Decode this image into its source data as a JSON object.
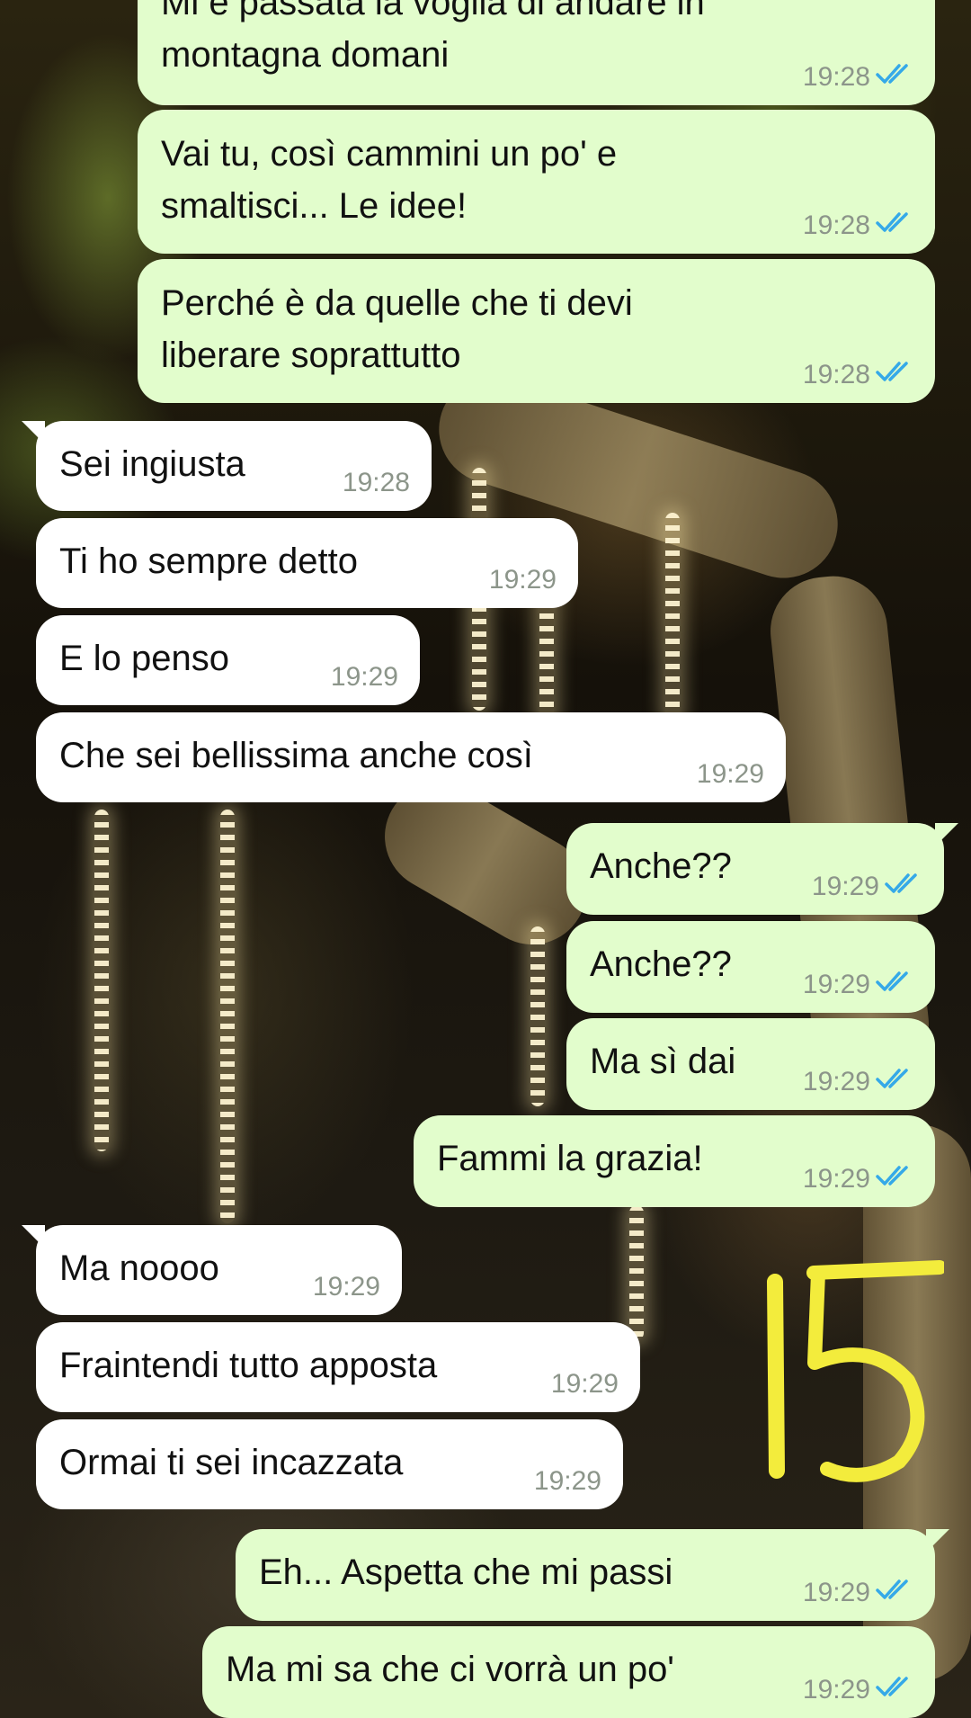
{
  "messages": [
    {
      "dir": "out",
      "text": "Mi è passata la voglia di andare in montagna domani",
      "time": "19:28",
      "read": true
    },
    {
      "dir": "out",
      "text": "Vai tu, così cammini un po' e smaltisci... Le idee!",
      "time": "19:28",
      "read": true
    },
    {
      "dir": "out",
      "text": "Perché è da quelle che ti devi liberare soprattutto",
      "time": "19:28",
      "read": true
    },
    {
      "dir": "in",
      "text": "Sei ingiusta",
      "time": "19:28"
    },
    {
      "dir": "in",
      "text": "Ti ho sempre detto",
      "time": "19:29"
    },
    {
      "dir": "in",
      "text": "E lo penso",
      "time": "19:29"
    },
    {
      "dir": "in",
      "text": "Che sei bellissima anche così",
      "time": "19:29"
    },
    {
      "dir": "out",
      "text": "Anche??",
      "time": "19:29",
      "read": true
    },
    {
      "dir": "out",
      "text": "Anche??",
      "time": "19:29",
      "read": true
    },
    {
      "dir": "out",
      "text": "Ma sì dai",
      "time": "19:29",
      "read": true
    },
    {
      "dir": "out",
      "text": "Fammi la grazia!",
      "time": "19:29",
      "read": true
    },
    {
      "dir": "in",
      "text": "Ma noooo",
      "time": "19:29"
    },
    {
      "dir": "in",
      "text": "Fraintendi tutto apposta",
      "time": "19:29"
    },
    {
      "dir": "in",
      "text": "Ormai ti sei incazzata",
      "time": "19:29"
    },
    {
      "dir": "out",
      "text": "Eh... Aspetta che mi passi",
      "time": "19:29",
      "read": true
    },
    {
      "dir": "out",
      "text": "Ma mi sa che ci vorrà un po'",
      "time": "19:29",
      "read": true
    }
  ],
  "annotation": {
    "text": "15",
    "color": "#f3ec3c"
  },
  "colors": {
    "outgoing_bubble": "#e2fdcc",
    "incoming_bubble": "#ffffff",
    "read_tick": "#35a9e8",
    "time_text": "#8c958a"
  }
}
